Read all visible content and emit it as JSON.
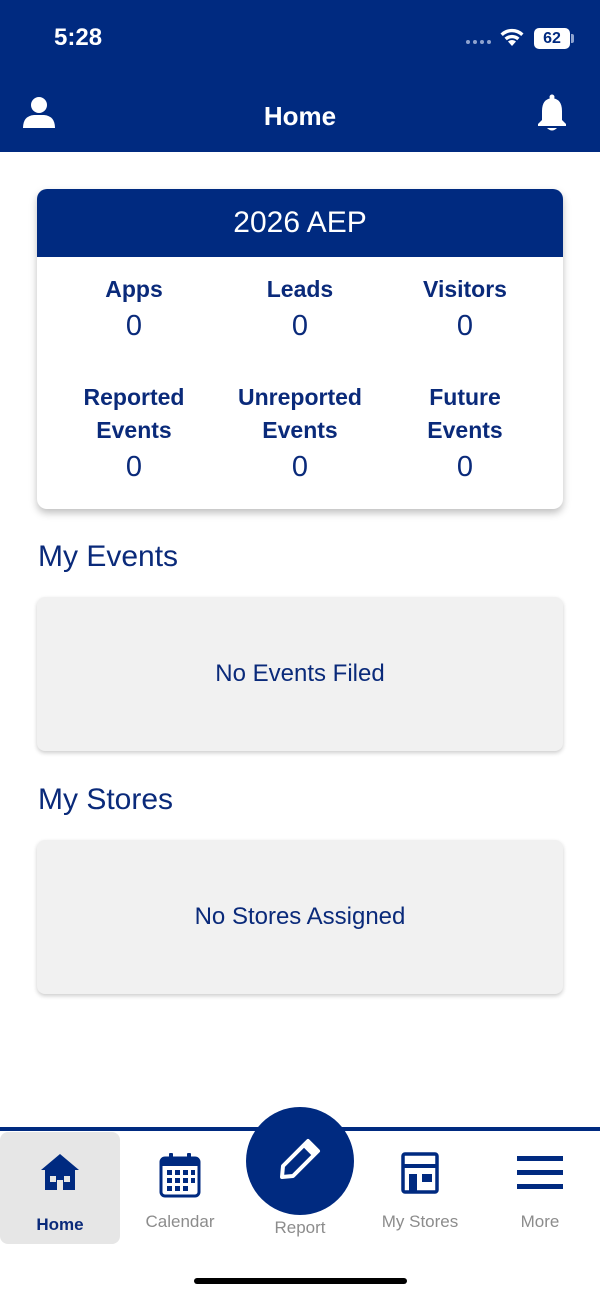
{
  "status_bar": {
    "time": "5:28",
    "battery": "62"
  },
  "header": {
    "title": "Home"
  },
  "summary": {
    "title": "2026 AEP",
    "stats": [
      {
        "label": "Apps",
        "value": "0"
      },
      {
        "label": "Leads",
        "value": "0"
      },
      {
        "label": "Visitors",
        "value": "0"
      },
      {
        "label_line1": "Reported",
        "label_line2": "Events",
        "value": "0"
      },
      {
        "label_line1": "Unreported",
        "label_line2": "Events",
        "value": "0"
      },
      {
        "label_line1": "Future",
        "label_line2": "Events",
        "value": "0"
      }
    ]
  },
  "my_events": {
    "title": "My Events",
    "empty_text": "No Events Filed"
  },
  "my_stores": {
    "title": "My Stores",
    "empty_text": "No Stores Assigned"
  },
  "tabs": [
    {
      "label": "Home",
      "icon": "home-icon",
      "active": true
    },
    {
      "label": "Calendar",
      "icon": "calendar-icon"
    },
    {
      "label": "Report",
      "icon": "pencil-icon"
    },
    {
      "label": "My Stores",
      "icon": "store-icon"
    },
    {
      "label": "More",
      "icon": "menu-icon"
    }
  ],
  "colors": {
    "primary": "#002a80",
    "text": "#0a2a7a",
    "inactive": "#8c8c8c",
    "box": "#f1f1f1"
  }
}
